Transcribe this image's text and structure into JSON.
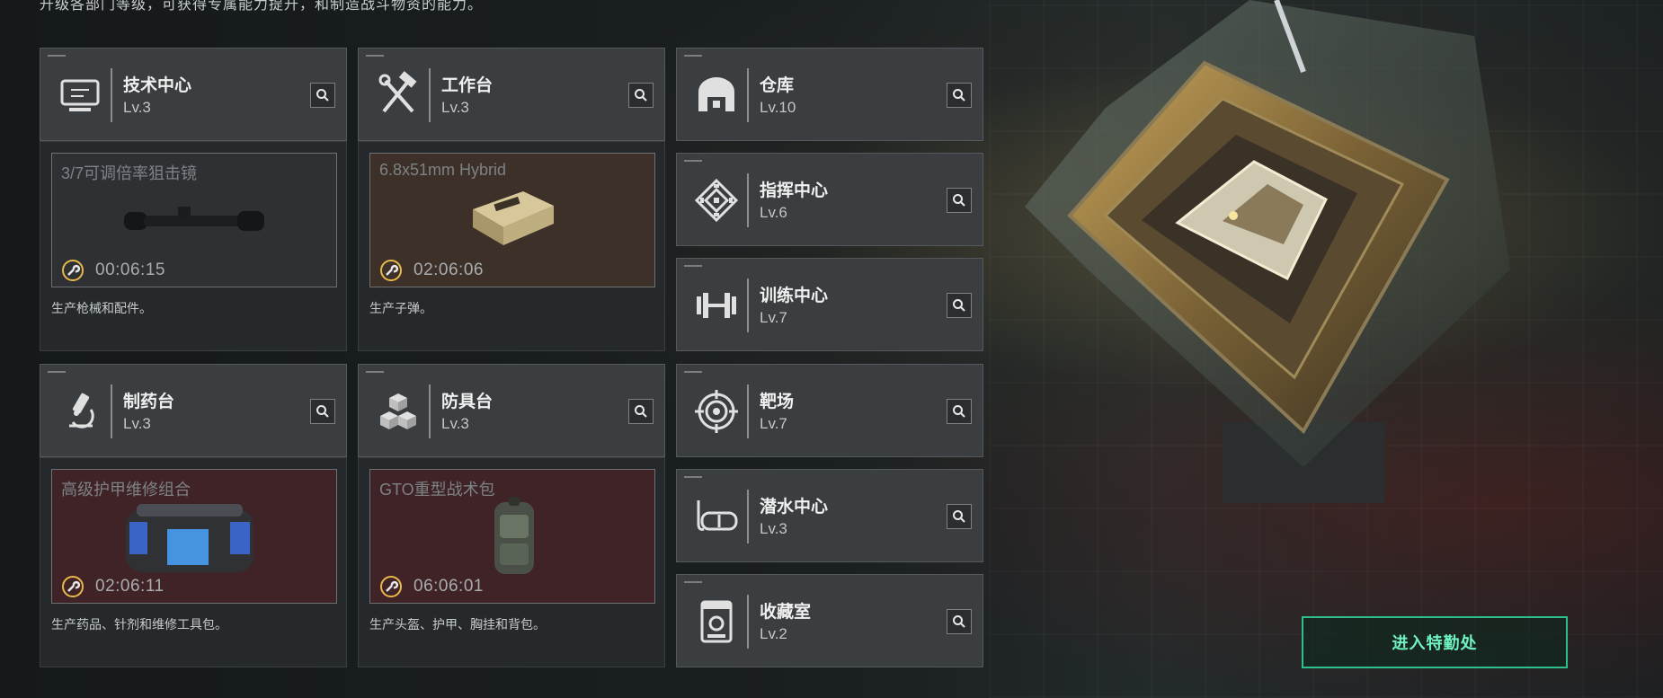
{
  "intro_text": "升级各部门等级，可获得专属能力提升，和制造战斗物资的能力。",
  "facilities": [
    {
      "name": "技术中心",
      "level": "Lv.3",
      "icon": "monitor-icon"
    },
    {
      "name": "工作台",
      "level": "Lv.3",
      "icon": "hammer-wrench-icon"
    },
    {
      "name": "仓库",
      "level": "Lv.10",
      "icon": "warehouse-icon"
    },
    {
      "name": "指挥中心",
      "level": "Lv.6",
      "icon": "command-emblem-icon"
    },
    {
      "name": "训练中心",
      "level": "Lv.7",
      "icon": "dumbbell-icon"
    },
    {
      "name": "制药台",
      "level": "Lv.3",
      "icon": "microscope-icon"
    },
    {
      "name": "防具台",
      "level": "Lv.3",
      "icon": "cubes-icon"
    },
    {
      "name": "靶场",
      "level": "Lv.7",
      "icon": "target-icon"
    },
    {
      "name": "潜水中心",
      "level": "Lv.3",
      "icon": "dive-mask-icon"
    },
    {
      "name": "收藏室",
      "level": "Lv.2",
      "icon": "display-case-icon"
    }
  ],
  "productions": [
    {
      "item": "3/7可调倍率狙击镜",
      "timer": "00:06:15",
      "desc": "生产枪械和配件。",
      "bg": "#2e3034",
      "image": "scope-image"
    },
    {
      "item": "6.8x51mm Hybrid",
      "timer": "02:06:06",
      "desc": "生产子弹。",
      "bg": "#3c3028",
      "image": "ammo-box-image"
    },
    {
      "item": "高级护甲维修组合",
      "timer": "02:06:11",
      "desc": "生产药品、针剂和维修工具包。",
      "bg": "#3f2326",
      "image": "repair-bag-image"
    },
    {
      "item": "GTO重型战术包",
      "timer": "06:06:01",
      "desc": "生产头盔、护甲、胸挂和背包。",
      "bg": "#3f2326",
      "image": "backpack-image"
    }
  ],
  "enter_button": "进入特勤处",
  "colors": {
    "accent": "#2fbf8a",
    "timer_icon": "#e8b94a"
  }
}
